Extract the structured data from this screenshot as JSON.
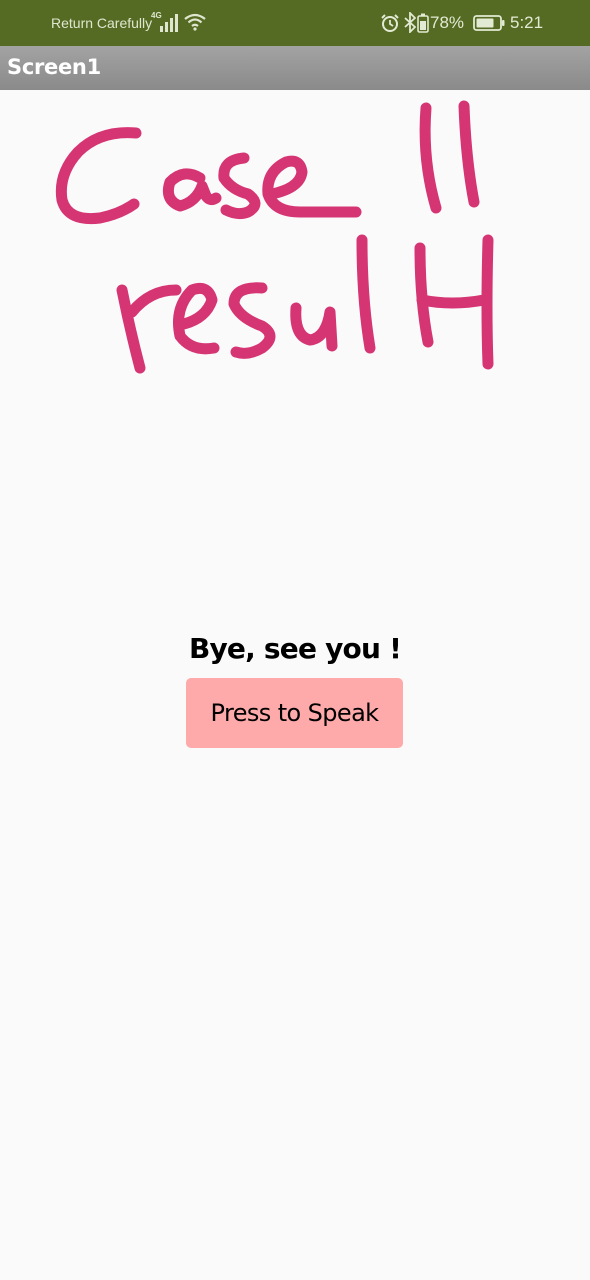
{
  "status_bar": {
    "carrier": "Return Carefully",
    "network_type": "4G",
    "battery_percent": "78%",
    "time": "5:21",
    "icons": [
      "signal-icon",
      "wifi-icon",
      "alarm-icon",
      "bluetooth-icon",
      "battery-icon"
    ],
    "background_color": "#556b23"
  },
  "app_bar": {
    "title": "Screen1"
  },
  "annotation": {
    "text": "Case 11 result",
    "color": "#d63574"
  },
  "main": {
    "message": "Bye, see you !",
    "speak_button_label": "Press to Speak",
    "speak_button_color": "#ffaaaa"
  }
}
